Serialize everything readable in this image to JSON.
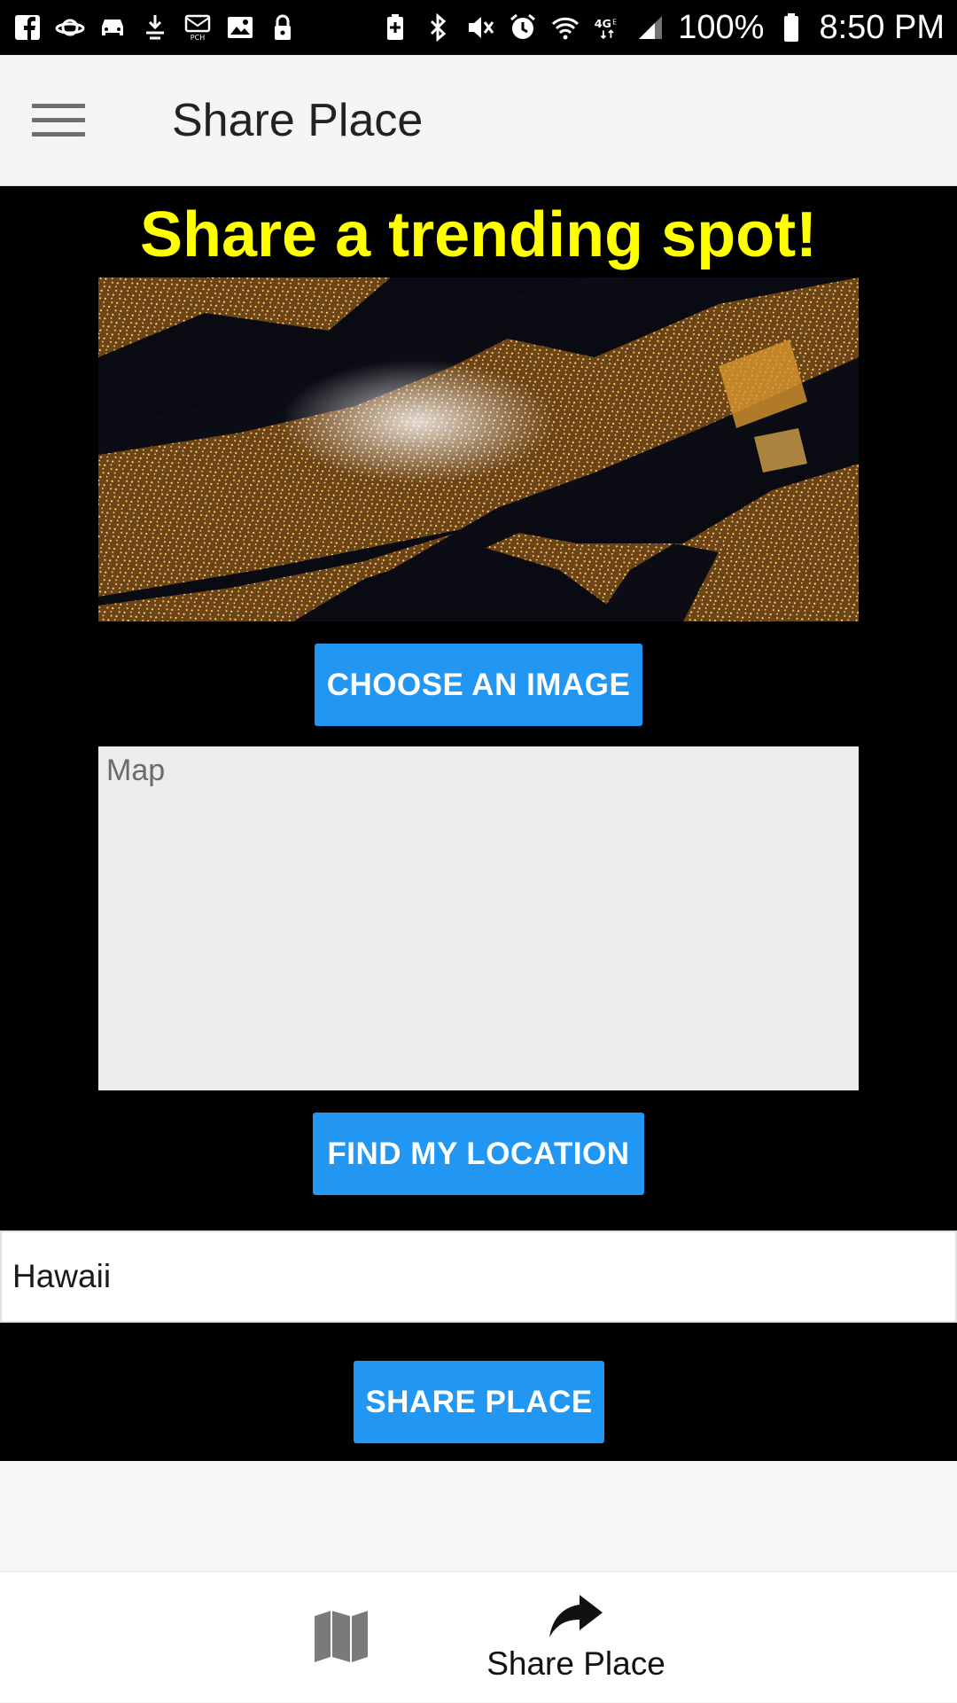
{
  "status_bar": {
    "left_icons": [
      "facebook-icon",
      "saturn-icon",
      "car-icon",
      "gesture-icon",
      "pch-icon",
      "image-icon",
      "lock-icon"
    ],
    "right_icons": [
      "battery-saver-icon",
      "bluetooth-icon",
      "mute-icon",
      "alarm-icon",
      "wifi-icon",
      "lte-icon",
      "signal-icon"
    ],
    "battery": "100%",
    "time": "8:50 PM"
  },
  "app_bar": {
    "title": "Share Place",
    "menu_icon": "hamburger-menu-icon"
  },
  "main": {
    "headline": "Share a trending spot!",
    "headline_color": "#ffff00",
    "image_alt": "night city aerial photo",
    "choose_image_label": "CHOOSE AN IMAGE",
    "map_label": "Map",
    "find_location_label": "FIND MY LOCATION",
    "place_name_value": "Hawaii",
    "share_place_label": "SHARE PLACE",
    "accent_color": "#2196f3"
  },
  "bottom_nav": {
    "tabs": [
      {
        "icon": "map-icon",
        "label": ""
      },
      {
        "icon": "share-arrow-icon",
        "label": "Share Place"
      }
    ]
  }
}
